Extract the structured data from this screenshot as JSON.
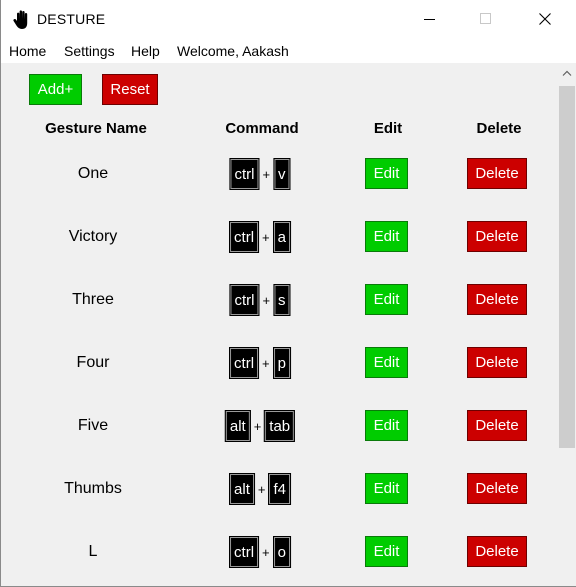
{
  "window": {
    "title": "DESTURE",
    "icons": {
      "app": "hand-icon",
      "minimize": "minimize-icon",
      "maximize": "maximize-icon",
      "close": "close-icon"
    }
  },
  "menu": [
    "Home",
    "Settings",
    "Help",
    "Welcome, Aakash"
  ],
  "toolbar": {
    "add_label": "Add+",
    "reset_label": "Reset"
  },
  "table": {
    "headers": [
      "Gesture Name",
      "Command",
      "Edit",
      "Delete"
    ],
    "rows": [
      {
        "name": "One",
        "keys": [
          "ctrl",
          "v"
        ],
        "edit": "Edit",
        "delete": "Delete"
      },
      {
        "name": "Victory",
        "keys": [
          "ctrl",
          "a"
        ],
        "edit": "Edit",
        "delete": "Delete"
      },
      {
        "name": "Three",
        "keys": [
          "ctrl",
          "s"
        ],
        "edit": "Edit",
        "delete": "Delete"
      },
      {
        "name": "Four",
        "keys": [
          "ctrl",
          "p"
        ],
        "edit": "Edit",
        "delete": "Delete"
      },
      {
        "name": "Five",
        "keys": [
          "alt",
          "tab"
        ],
        "edit": "Edit",
        "delete": "Delete"
      },
      {
        "name": "Thumbs",
        "keys": [
          "alt",
          "f4"
        ],
        "edit": "Edit",
        "delete": "Delete"
      },
      {
        "name": "L",
        "keys": [
          "ctrl",
          "o"
        ],
        "edit": "Edit",
        "delete": "Delete"
      }
    ]
  },
  "key_separator": "+",
  "colors": {
    "accent_green": "#00cc00",
    "accent_red": "#cc0000",
    "key_bg": "#000000",
    "panel_bg": "#f0f0f0"
  }
}
